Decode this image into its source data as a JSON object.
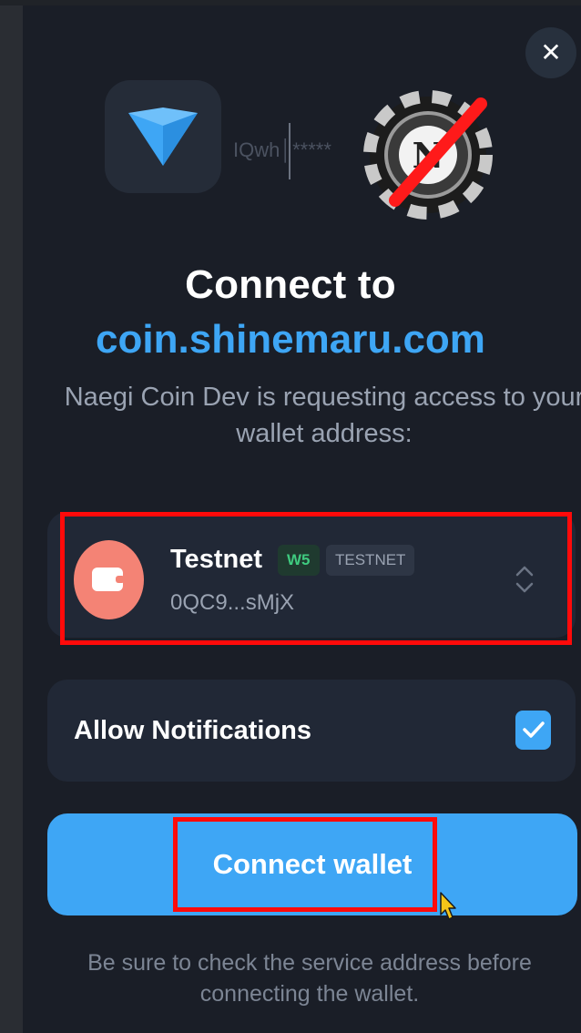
{
  "dialog": {
    "close_icon": "close-icon",
    "password_mask": "IQwh│*****",
    "title": "Connect to",
    "domain": "coin.shinemaru.com",
    "subtitle": "Naegi Coin Dev is requesting access to your wallet address:",
    "wallet": {
      "name": "Testnet",
      "version_badge": "W5",
      "network_badge": "TESTNET",
      "address": "0QC9...sMjX",
      "icon": "wallet-icon"
    },
    "notifications": {
      "label": "Allow Notifications",
      "checked": true
    },
    "connect_label": "Connect wallet",
    "footer_note": "Be sure to check the service address before connecting the wallet."
  },
  "colors": {
    "panel_bg": "#1a1e27",
    "card_bg": "#212836",
    "accent_blue": "#3ea6f5",
    "avatar_coral": "#f48375",
    "highlight_red": "#ff0a0a"
  }
}
